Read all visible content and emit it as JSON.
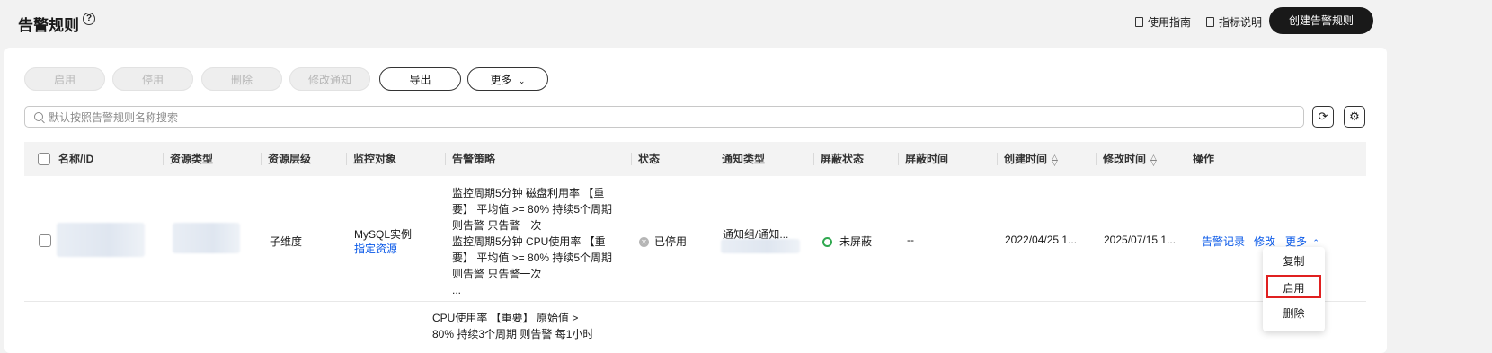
{
  "header": {
    "title": "告警规则",
    "help_symbol": "?",
    "guide_label": "使用指南",
    "metric_label": "指标说明",
    "create_label": "创建告警规则"
  },
  "toolbar": {
    "enable": "启用",
    "disable": "停用",
    "delete": "删除",
    "modify_notify": "修改通知",
    "export": "导出",
    "more": "更多"
  },
  "search": {
    "placeholder": "默认按照告警规则名称搜索"
  },
  "columns": [
    "名称/ID",
    "资源类型",
    "资源层级",
    "监控对象",
    "告警策略",
    "状态",
    "通知类型",
    "屏蔽状态",
    "屏蔽时间",
    "创建时间",
    "修改时间",
    "操作"
  ],
  "rows": [
    {
      "level": "子维度",
      "monitor_object": "MySQL实例",
      "monitor_link": "指定资源",
      "strategy": [
        "监控周期5分钟 磁盘利用率 【重",
        "要】 平均值 >= 80% 持续5个周期",
        "则告警 只告警一次",
        "监控周期5分钟 CPU使用率 【重",
        "要】 平均值 >= 80% 持续5个周期",
        "则告警 只告警一次",
        "..."
      ],
      "status": "已停用",
      "notify_type": "通知组/通知...",
      "shield_status": "未屏蔽",
      "shield_time": "--",
      "created": "2022/04/25 1...",
      "modified": "2025/07/15 1...",
      "actions": {
        "records": "告警记录",
        "modify": "修改",
        "more": "更多"
      }
    },
    {
      "strategy": [
        "CPU使用率 【重要】 原始值 >",
        "80% 持续3个周期 则告警 每1小时"
      ]
    }
  ],
  "more_menu": [
    "复制",
    "启用",
    "删除"
  ],
  "colors": {
    "primary_link": "#0a59e8",
    "highlight_border": "#e02020",
    "status_ok": "#2fa84f"
  }
}
